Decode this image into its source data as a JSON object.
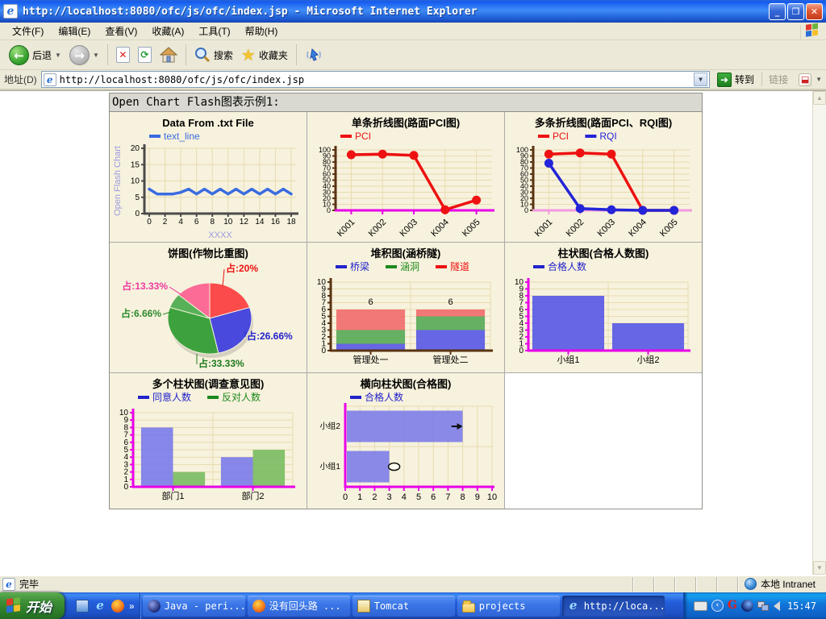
{
  "window": {
    "title": "http://localhost:8080/ofc/js/ofc/index.jsp - Microsoft Internet Explorer"
  },
  "menu": {
    "items": [
      "文件(F)",
      "编辑(E)",
      "查看(V)",
      "收藏(A)",
      "工具(T)",
      "帮助(H)"
    ]
  },
  "toolbar": {
    "back_label": "后退",
    "search_label": "搜索",
    "favorites_label": "收藏夹"
  },
  "address": {
    "label": "地址(D)",
    "value": "http://localhost:8080/ofc/js/ofc/index.jsp",
    "go_label": "转到",
    "links_label": "链接"
  },
  "page": {
    "heading": "Open Chart Flash图表示例1:"
  },
  "status": {
    "done": "完毕",
    "zone": "本地 Intranet"
  },
  "taskbar": {
    "start_label": "开始",
    "quick_launch_icons": [
      "show-desktop-icon",
      "ie-icon",
      "firefox-icon"
    ],
    "buttons": [
      {
        "label": "Java - peri...",
        "icon": "eclipse-icon",
        "active": false
      },
      {
        "label": "没有回头路 ...",
        "icon": "firefox-icon",
        "active": false
      },
      {
        "label": "Tomcat",
        "icon": "tomcat-icon",
        "active": false
      },
      {
        "label": "projects",
        "icon": "folder-icon",
        "active": false
      },
      {
        "label": "http://loca...",
        "icon": "ie-icon",
        "active": true
      }
    ],
    "time": "15:47"
  },
  "chart_data": [
    {
      "type": "line",
      "title": "Data From .txt File",
      "ylabel": "Open Flash Chart",
      "xlabel": "XXXX",
      "axis_title_color": "#9b9be0",
      "legend": [
        {
          "label": "text_line",
          "color": "#3a6ce0"
        }
      ],
      "x_ticks": [
        0,
        2,
        4,
        6,
        8,
        10,
        12,
        14,
        16,
        18
      ],
      "series": [
        {
          "name": "text_line",
          "color": "#3a6ce0",
          "values": [
            7.5,
            6,
            6,
            6,
            6.5,
            7.5,
            6,
            7.5,
            6,
            7.5,
            6,
            7.5,
            6,
            7.5,
            6,
            7.5,
            6,
            7.5,
            6
          ]
        }
      ],
      "ylim": [
        0,
        20
      ],
      "ytick": 5,
      "x_axis_color": "#4a4a4a",
      "y_axis_color": "#4a4a4a",
      "grid": "both",
      "legend_position": "top-left"
    },
    {
      "type": "line",
      "title": "单条折线图(路面PCI图)",
      "legend": [
        {
          "label": "PCI",
          "color": "#ee1111"
        }
      ],
      "categories": [
        "K001",
        "K002",
        "K003",
        "K004",
        "K005"
      ],
      "series": [
        {
          "name": "PCI",
          "color": "#ee1111",
          "dots": true,
          "values": [
            92,
            93,
            91,
            1,
            17
          ]
        }
      ],
      "ylim": [
        0,
        100
      ],
      "ytick": 10,
      "rotate_x_labels": true,
      "x_axis_color": "#e800e8",
      "y_axis_color": "#5a3312",
      "grid": "both",
      "legend_position": "top-left"
    },
    {
      "type": "line",
      "title": "多条折线图(路面PCI、RQI图)",
      "legend": [
        {
          "label": "PCI",
          "color": "#ee1111"
        },
        {
          "label": "RQI",
          "color": "#2424d8"
        }
      ],
      "categories": [
        "K001",
        "K002",
        "K003",
        "K004",
        "K005"
      ],
      "series": [
        {
          "name": "PCI",
          "color": "#ee1111",
          "dots": true,
          "values": [
            93,
            95,
            93,
            0,
            0
          ]
        },
        {
          "name": "RQI",
          "color": "#2424d8",
          "dots": true,
          "values": [
            78,
            3,
            1,
            0,
            0
          ]
        }
      ],
      "ylim": [
        0,
        100
      ],
      "ytick": 10,
      "rotate_x_labels": true,
      "x_axis_color": "#f09ae0",
      "y_axis_color": "#5a3312",
      "grid": "both",
      "legend_position": "top-left"
    },
    {
      "type": "pie",
      "title": "饼图(作物比重图)",
      "slices": [
        {
          "label": "占:20%",
          "value": 20,
          "color": "#fb4b4b",
          "label_color": "#ee1111"
        },
        {
          "label": "占:26.66%",
          "value": 26.66,
          "color": "#4949dd",
          "label_color": "#2222cc"
        },
        {
          "label": "占:33.33%",
          "value": 33.33,
          "color": "#3da23d",
          "label_color": "#1d7a1d"
        },
        {
          "label": "占:6.66%",
          "value": 6.66,
          "color": "#58b158",
          "label_color": "#2d8a2d"
        },
        {
          "label": "占:13.33%",
          "value": 13.33,
          "color": "#fb6b96",
          "label_color": "#ee3aa0"
        }
      ]
    },
    {
      "type": "stacked-bar",
      "title": "堆积图(涵桥隧)",
      "categories": [
        "管理处一",
        "管理处二"
      ],
      "series": [
        {
          "name": "桥梁",
          "color": "#5757e5",
          "label_color": "#2222cc",
          "values": [
            1,
            3
          ]
        },
        {
          "name": "涵洞",
          "color": "#55a855",
          "label_color": "#1d8a1d",
          "values": [
            2,
            2
          ]
        },
        {
          "name": "隧道",
          "color": "#f06a6a",
          "label_color": "#ee1111",
          "values": [
            3,
            1
          ]
        }
      ],
      "totals": [
        6,
        6
      ],
      "ylim": [
        0,
        10
      ],
      "ytick": 1,
      "x_axis_color": "#5a3312",
      "y_axis_color": "#5a3312",
      "grid": "both",
      "legend_position": "top-left"
    },
    {
      "type": "bar",
      "title": "柱状图(合格人数图)",
      "categories": [
        "小组1",
        "小组2"
      ],
      "legend": [
        {
          "label": "合格人数",
          "color": "#2222cc"
        }
      ],
      "series": [
        {
          "name": "合格人数",
          "color": "#5757e5",
          "values": [
            8,
            4
          ]
        }
      ],
      "ylim": [
        0,
        10
      ],
      "ytick": 1,
      "x_axis_color": "#e800e8",
      "y_axis_color": "#e800e8",
      "grid": "both",
      "legend_position": "top-left"
    },
    {
      "type": "bar",
      "title": "多个柱状图(调查意见图)",
      "categories": [
        "部门1",
        "部门2"
      ],
      "legend": [
        {
          "label": "同意人数",
          "color": "#2222cc"
        },
        {
          "label": "反对人数",
          "color": "#1d8a1d"
        }
      ],
      "series": [
        {
          "name": "同意人数",
          "color": "#7d7de9",
          "values": [
            8,
            4
          ]
        },
        {
          "name": "反对人数",
          "color": "#7cbd63",
          "values": [
            2,
            5
          ]
        }
      ],
      "ylim": [
        0,
        10
      ],
      "ytick": 1,
      "x_axis_color": "#e800e8",
      "y_axis_color": "#e800e8",
      "grid": "both",
      "legend_position": "top-left"
    },
    {
      "type": "hbar",
      "title": "横向柱状图(合格图)",
      "legend": [
        {
          "label": "合格人数",
          "color": "#2222cc"
        }
      ],
      "categories": [
        "小组2",
        "小组1"
      ],
      "series": [
        {
          "name": "合格人数",
          "color": "#7d7de9",
          "values": [
            8,
            3
          ]
        }
      ],
      "xlim": [
        0,
        10
      ],
      "xtick": 1,
      "markers": [
        "arrow",
        "ellipse"
      ],
      "x_axis_color": "#e800e8",
      "y_axis_color": "#e800e8",
      "grid": "both",
      "legend_position": "top-left"
    }
  ]
}
